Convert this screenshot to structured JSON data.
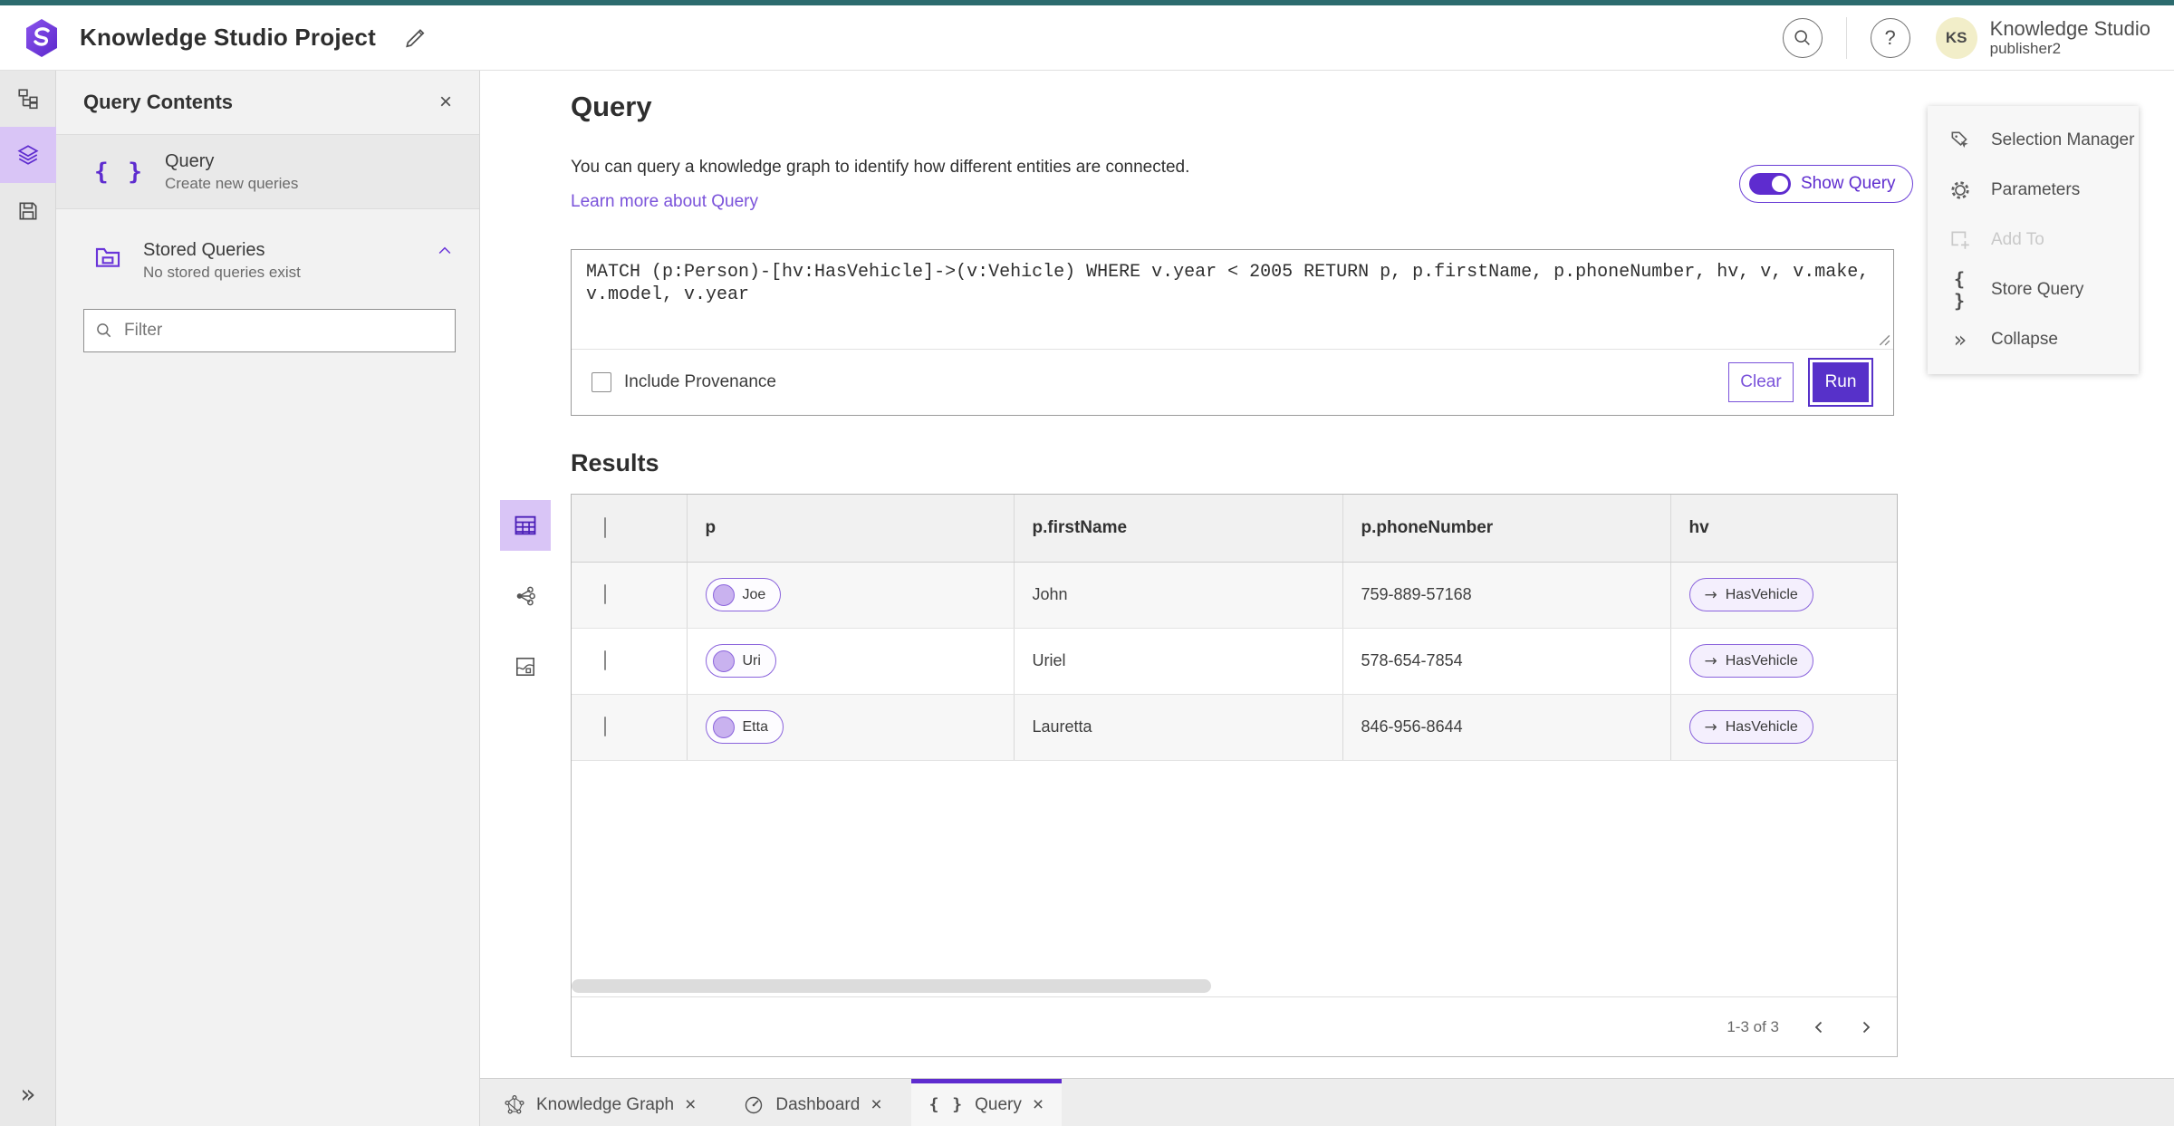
{
  "header": {
    "title": "Knowledge Studio Project",
    "user": {
      "initials": "KS",
      "name": "Knowledge Studio",
      "role": "publisher2"
    }
  },
  "contents_panel": {
    "title": "Query Contents",
    "query_item": {
      "label": "Query",
      "description": "Create new queries"
    },
    "stored_queries": {
      "label": "Stored Queries",
      "description": "No stored queries exist"
    },
    "filter": {
      "placeholder": "Filter"
    }
  },
  "query_section": {
    "heading": "Query",
    "description": "You can query a knowledge graph to identify how different entities are connected.",
    "learn_more_link": "Learn more about Query",
    "show_query_toggle": "Show Query",
    "query_text": "MATCH (p:Person)-[hv:HasVehicle]->(v:Vehicle) WHERE v.year < 2005 RETURN p, p.firstName, p.phoneNumber, hv, v, v.make, v.model, v.year",
    "include_provenance": "Include Provenance",
    "clear_button": "Clear",
    "run_button": "Run"
  },
  "tools_menu": {
    "items": [
      {
        "label": "Selection Manager",
        "icon": "selection-manager-icon",
        "disabled": false
      },
      {
        "label": "Parameters",
        "icon": "gear-icon",
        "disabled": false
      },
      {
        "label": "Add To",
        "icon": "add-to-icon",
        "disabled": true
      },
      {
        "label": "Store Query",
        "icon": "braces-icon",
        "disabled": false
      },
      {
        "label": "Collapse",
        "icon": "double-chevron-right-icon",
        "disabled": false
      }
    ]
  },
  "results": {
    "heading": "Results",
    "columns": [
      "p",
      "p.firstName",
      "p.phoneNumber",
      "hv"
    ],
    "rows": [
      {
        "p": "Joe",
        "p_firstName": "John",
        "p_phoneNumber": "759-889-57168",
        "hv": "HasVehicle"
      },
      {
        "p": "Uri",
        "p_firstName": "Uriel",
        "p_phoneNumber": "578-654-7854",
        "hv": "HasVehicle"
      },
      {
        "p": "Etta",
        "p_firstName": "Lauretta",
        "p_phoneNumber": "846-956-8644",
        "hv": "HasVehicle"
      }
    ],
    "pagination": {
      "range_label": "1-3 of 3"
    }
  },
  "bottom_tabs": [
    {
      "label": "Knowledge Graph",
      "icon": "knowledge-graph-icon",
      "active": false
    },
    {
      "label": "Dashboard",
      "icon": "dashboard-gauge-icon",
      "active": false
    },
    {
      "label": "Query",
      "icon": "braces-icon",
      "active": true
    }
  ],
  "colors": {
    "accent_purple": "#5E2CCF",
    "accent_purple_light": "#D9C5F6",
    "link_purple": "#7A52DA",
    "top_strip_teal": "#2C6B6E",
    "avatar_yellow": "#F2EEC9"
  }
}
